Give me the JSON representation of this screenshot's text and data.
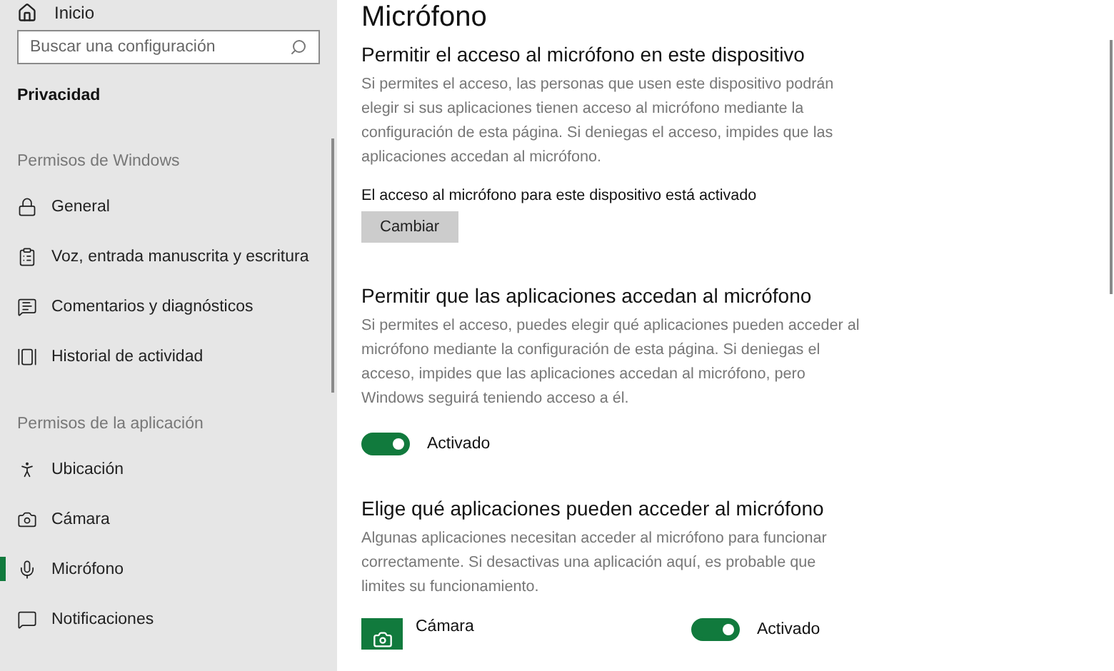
{
  "sidebar": {
    "home": "Inicio",
    "search": {
      "placeholder": "Buscar una configuración"
    },
    "category": "Privacidad",
    "groups": [
      {
        "title": "Permisos de Windows",
        "items": [
          {
            "label": "General",
            "selected": false
          },
          {
            "label": "Voz, entrada manuscrita y escritura",
            "selected": false
          },
          {
            "label": "Comentarios y diagnósticos",
            "selected": false
          },
          {
            "label": "Historial de actividad",
            "selected": false
          }
        ]
      },
      {
        "title": "Permisos de la aplicación",
        "items": [
          {
            "label": "Ubicación",
            "selected": false
          },
          {
            "label": "Cámara",
            "selected": false
          },
          {
            "label": "Micrófono",
            "selected": true
          },
          {
            "label": "Notificaciones",
            "selected": false
          }
        ]
      }
    ]
  },
  "page_title": "Micrófono",
  "sections": [
    {
      "kind": "button",
      "heading": "Permitir el acceso al micrófono en este dispositivo",
      "description": "Si permites el acceso, las personas que usen este dispositivo podrán elegir si sus aplicaciones tienen acceso al micrófono mediante la configuración de esta página. Si deniegas el acceso, impides que las aplicaciones accedan al micrófono.",
      "status": "El acceso al micrófono para este dispositivo está activado",
      "button": "Cambiar"
    },
    {
      "kind": "toggle",
      "heading": "Permitir que las aplicaciones accedan al micrófono",
      "description": "Si permites el acceso, puedes elegir qué aplicaciones pueden acceder al micrófono mediante la configuración de esta página. Si deniegas el acceso, impides que las aplicaciones accedan al micrófono, pero Windows seguirá teniendo acceso a él.",
      "toggle": {
        "on": true,
        "label": "Activado"
      }
    },
    {
      "kind": "apps",
      "heading": "Elige qué aplicaciones pueden acceder al micrófono",
      "description": "Algunas aplicaciones necesitan acceder al micrófono para funcionar correctamente. Si desactivas una aplicación aquí, es probable que limites su funcionamiento.",
      "apps": [
        {
          "name": "Cámara",
          "on": true,
          "label": "Activado"
        }
      ]
    }
  ]
}
